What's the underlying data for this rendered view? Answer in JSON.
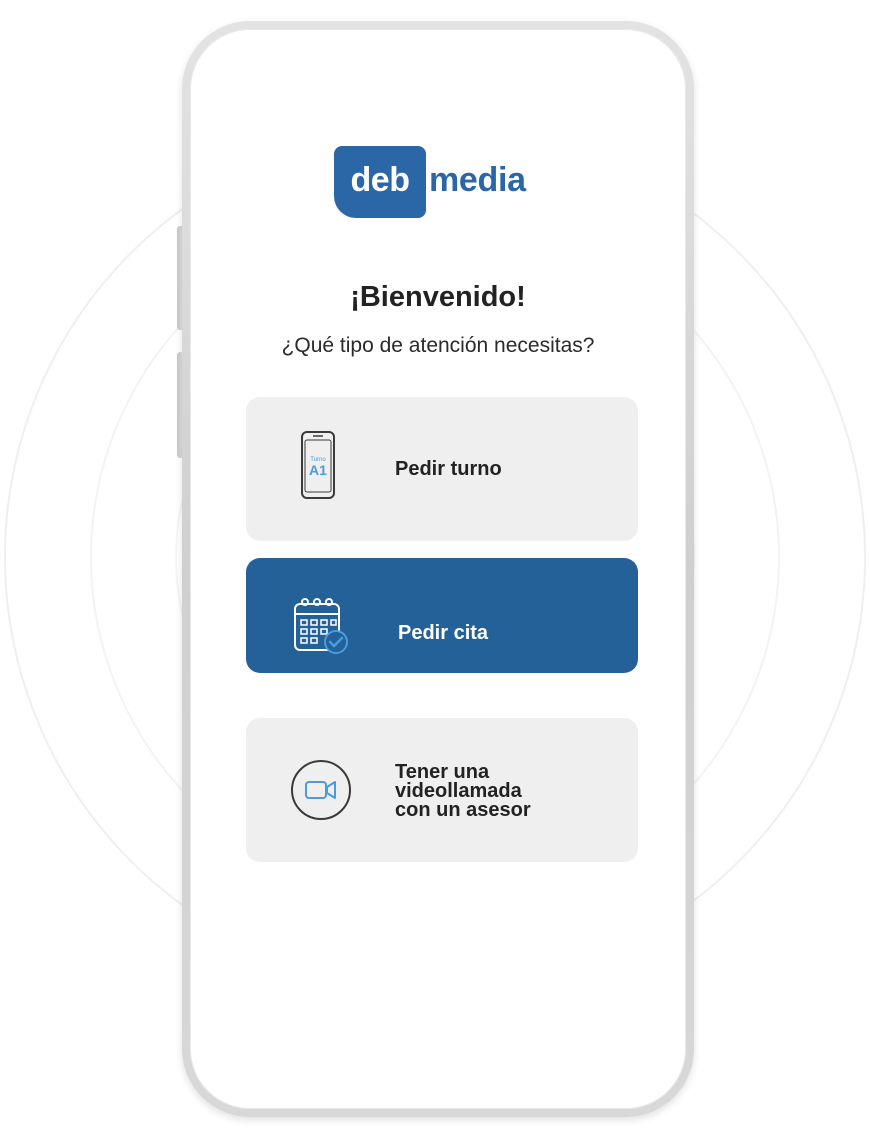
{
  "brand": {
    "logo_box_text": "deb",
    "logo_word": "media",
    "color": "#2b66a6"
  },
  "welcome": {
    "title": "¡Bienvenido!",
    "question": "¿Qué tipo de atención necesitas?"
  },
  "options": [
    {
      "label": "Pedir turno",
      "icon": "phone-turn-icon",
      "icon_text_small": "Turno",
      "icon_text_big": "A1",
      "selected": false
    },
    {
      "label": "Pedir cita",
      "icon": "calendar-check-icon",
      "selected": true
    },
    {
      "label": "Tener una\nvideollamada\ncon un asesor",
      "icon": "video-camera-icon",
      "selected": false
    }
  ],
  "colors": {
    "selected_bg": "#236198",
    "card_bg": "#efefef",
    "icon_accent": "#4a9be0"
  }
}
